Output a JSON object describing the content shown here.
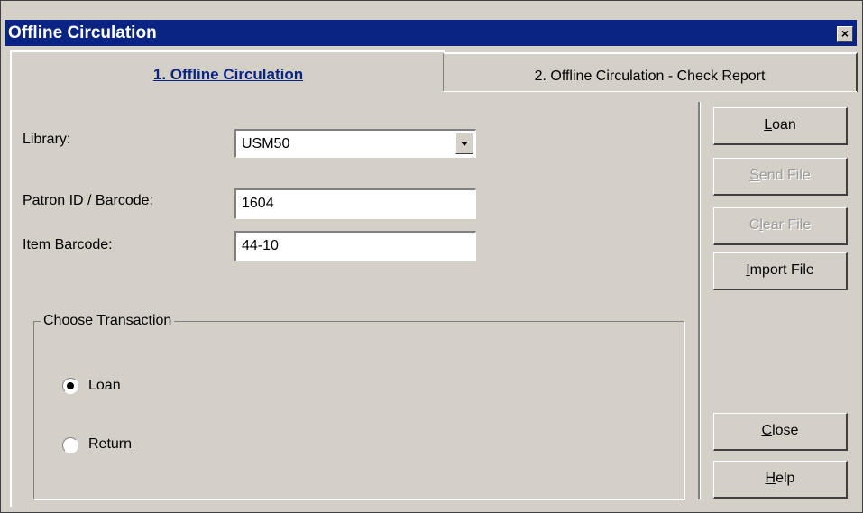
{
  "window": {
    "title": "Offline Circulation",
    "close_glyph": "×"
  },
  "tabs": [
    {
      "label": "1. Offline Circulation",
      "active": true
    },
    {
      "label": "2. Offline Circulation - Check Report",
      "active": false
    }
  ],
  "form": {
    "library_label": "Library:",
    "library_value": "USM50",
    "patron_label": "Patron ID / Barcode:",
    "patron_value": "1604",
    "item_label": "Item Barcode:",
    "item_value": "44-10"
  },
  "transaction": {
    "group_label": "Choose Transaction",
    "options": [
      {
        "label": "Loan",
        "selected": true
      },
      {
        "label": "Return",
        "selected": false
      }
    ]
  },
  "buttons": {
    "loan": {
      "mnemonic": "L",
      "rest": "oan"
    },
    "send_file": {
      "mnemonic": "S",
      "rest": "end File"
    },
    "clear_file": {
      "pre": "C",
      "mnemonic": "l",
      "rest": "ear File"
    },
    "import_file": {
      "mnemonic": "I",
      "rest": "mport File"
    },
    "close": {
      "mnemonic": "C",
      "rest": "lose"
    },
    "help": {
      "mnemonic": "H",
      "rest": "elp"
    }
  }
}
